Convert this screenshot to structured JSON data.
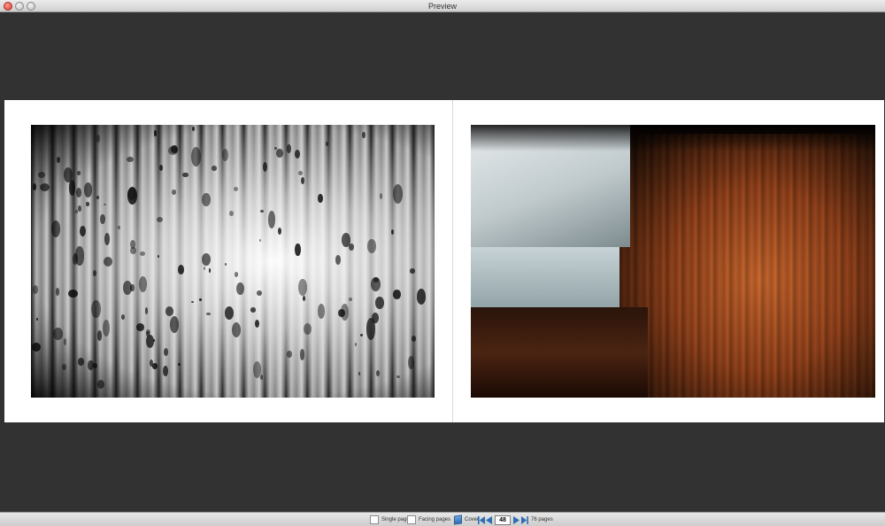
{
  "window": {
    "title": "Preview"
  },
  "toolbar": {
    "single_page_label": "Single page",
    "facing_pages_label": "Facing pages",
    "cover_label": "Cover",
    "current_page": "48",
    "total_pages_label": "76 pages"
  },
  "colors": {
    "background": "#323232",
    "page": "#ffffff",
    "toolbar": "#dadada",
    "accent": "#2f6db3"
  },
  "icons": {
    "close": "close-icon",
    "minimize": "minimize-icon",
    "zoom": "zoom-icon",
    "first": "first-page-icon",
    "previous": "previous-page-icon",
    "next": "next-page-icon",
    "last": "last-page-icon",
    "cover": "cover-icon"
  }
}
